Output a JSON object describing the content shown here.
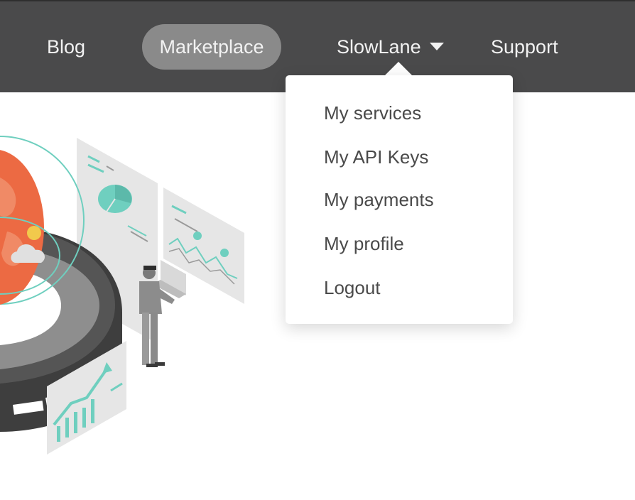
{
  "nav": {
    "blog": "Blog",
    "marketplace": "Marketplace",
    "user": "SlowLane",
    "support": "Support"
  },
  "dropdown": {
    "items": [
      "My services",
      "My API Keys",
      "My payments",
      "My profile",
      "Logout"
    ]
  },
  "colors": {
    "navbar": "#4a4a4b",
    "active_pill": "#8a8a8a",
    "accent_teal": "#6fcfbf",
    "globe_orange": "#ec6a43"
  }
}
